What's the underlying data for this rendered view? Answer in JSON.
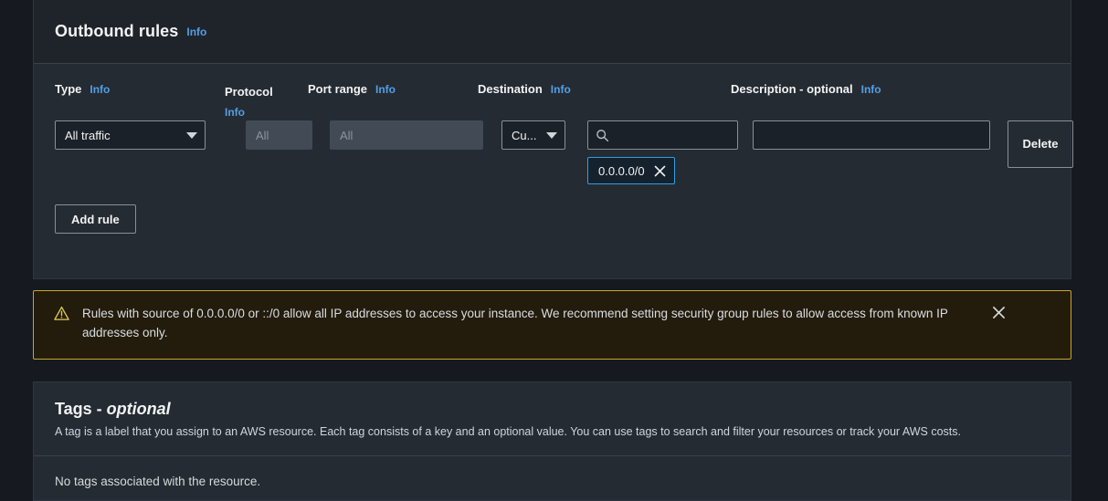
{
  "colors": {
    "page_bg": "#16191f",
    "card_bg": "#252b33",
    "header_bg": "#1f242b",
    "accent_link": "#539fe5",
    "warning_border": "#c8a727",
    "warning_bg": "#231c0d",
    "token_border": "#2ea0e0",
    "disabled_field": "#414a55"
  },
  "rules_card": {
    "title": "Outbound rules",
    "info_label": "Info",
    "columns": [
      {
        "label": "Type",
        "info": "Info"
      },
      {
        "label": "Protocol",
        "info": "Info"
      },
      {
        "label": "Port range",
        "info": "Info"
      },
      {
        "label": "Destination",
        "info": "Info"
      },
      {
        "label": "Description - optional",
        "info": "Info"
      }
    ],
    "rule": {
      "type_value": "All traffic",
      "protocol_placeholder": "All",
      "port_placeholder": "All",
      "destination_type_value": "Cu...",
      "destination_search_placeholder": "",
      "destination_search_value": "",
      "destination_token": "0.0.0.0/0",
      "description_value": "",
      "description_placeholder": "",
      "delete_label": "Delete"
    },
    "add_rule_label": "Add rule"
  },
  "alert": {
    "message": "Rules with source of 0.0.0.0/0 or ::/0 allow all IP addresses to access your instance. We recommend setting security group rules to allow access from known IP addresses only."
  },
  "tags_card": {
    "title_main": "Tags - ",
    "title_em": "optional",
    "description": "A tag is a label that you assign to an AWS resource. Each tag consists of a key and an optional value. You can use tags to search and filter your resources or track your AWS costs.",
    "empty_text": "No tags associated with the resource."
  }
}
